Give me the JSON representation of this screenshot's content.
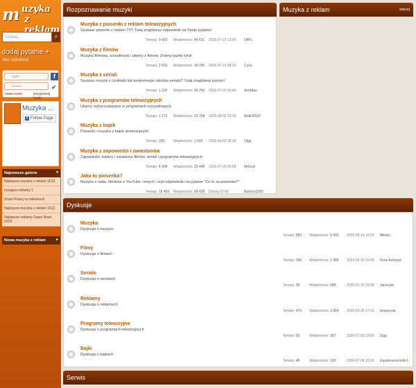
{
  "sidebar": {
    "logo_line1": "uzyka",
    "logo_line2": "z reklam",
    "logo_initial": "m",
    "search_placeholder": "Szukaj...",
    "ask_label": "dodaj pytanie +",
    "ask_sub": "bez rejestracji",
    "login_placeholder": "login",
    "password_placeholder": "••••••••",
    "new_account": "nowe konto",
    "forgot": "przypomnij hasło",
    "fb_title": "Muzyka ...",
    "fb_follow": "Follow Page",
    "latest_head": "Najnowsze galerie",
    "latest_links": [
      "Najlepsza muzyka z reklam 2013",
      "Irytujące reklamy 1",
      "Znani Polacy w reklamach",
      "Najlepsza muzyka z reklam 2012",
      "Najlepsze reklamy Super Bowl 2019"
    ],
    "new_music_head": "Nowa muzyka z reklam"
  },
  "recognition": {
    "title": "Rozpoznawanie muzyki",
    "rows": [
      {
        "title": "Muzyka z piosenki z reklam telewizyjnych",
        "desc": "Szukasz piosenki z reklam TV? Tutaj znajdziesz odpowiedź na Twoje pytanie!",
        "topics": "9 420",
        "posts": "44 611",
        "date": "2026-07-21 13:05",
        "user": "OliPL"
      },
      {
        "title": "Muzyka z filmów",
        "desc": "Muzyka filmowa, soundtracki i utwory z filmów. Znamy każdy tytuł!",
        "topics": "2 503",
        "posts": "18 295",
        "date": "2026-07-21 08:20",
        "user": "Cyna"
      },
      {
        "title": "Muzyka z seriali",
        "desc": "Szukasz muzyki z czołówki lub konkretnego odcinka serialu? Tutaj znajdziesz pomoc!",
        "topics": "1 232",
        "posts": "56 250",
        "date": "2026-07-20 00:40",
        "user": "AnnMaa"
      },
      {
        "title": "Muzyka z programów telewizyjnych",
        "desc": "Utwory wykorzystywane w programach rozrywkowych",
        "topics": "1 172",
        "posts": "23 758",
        "date": "2026-08-02 22:29",
        "user": "Malk25537"
      },
      {
        "title": "Muzyka z bajek",
        "desc": "Piosenki i muzyka z bajek animowanych",
        "topics": "330",
        "posts": "1 566",
        "date": "2026-04-02 09:39",
        "user": "Olga"
      },
      {
        "title": "Muzyka z zapowiedzi i zwiastunów",
        "desc": "Zapowiedzi, trailery i zwiastuny filmów, seriali i programów telewizyjnych",
        "topics": "4 099",
        "posts": "25 448",
        "date": "2026-07-20 02:58",
        "user": "MrKruk"
      },
      {
        "title": "Jaka to piosenka?",
        "desc": "Muzyka z radia, filmików z YouTube i innych, czyli odpowiedzi na pytanie \"Co to za piosenka?\"",
        "topics": "18 469",
        "posts": "68 609",
        "date": "Dzisiaj 03:09",
        "user": "Bartosz1992"
      }
    ]
  },
  "ads_panel": {
    "title": "Muzyka z reklam",
    "more": "więcej"
  },
  "discussions": {
    "title": "Dyskusje",
    "rows": [
      {
        "title": "Muzyka",
        "desc": "Dyskusja o muzyce",
        "topics": "850",
        "posts": "5 403",
        "date": "2026-05-14 12:53",
        "user": "Mimen"
      },
      {
        "title": "Filmy",
        "desc": "Dyskusja o filmach",
        "topics": "390",
        "posts": "1 368",
        "date": "2024-03-16 23:09",
        "user": "Fiora Ackroyd"
      },
      {
        "title": "Seriale",
        "desc": "Dyskusja o serialach",
        "topics": "90",
        "posts": "588",
        "date": "2025-01-16 20:08",
        "user": "Jareczka"
      },
      {
        "title": "Reklamy",
        "desc": "Dyskusja o reklamach",
        "topics": "470",
        "posts": "3 964",
        "date": "2026-03-20 17:13",
        "user": "bowarysia"
      },
      {
        "title": "Programy telewizyjne",
        "desc": "Dyskusja o programach telewizyjnych",
        "topics": "55",
        "posts": "187",
        "date": "2026-07-02 23:09",
        "user": "Zigg"
      },
      {
        "title": "Bajki",
        "desc": "Dyskusja o bajkach",
        "topics": "48",
        "posts": "195",
        "date": "2026-07-06 10:20",
        "user": "itsjustmemichelle1"
      }
    ]
  },
  "service": {
    "title": "Serwis"
  },
  "labels": {
    "topics": "Tematy:",
    "posts": "Wiadomości:"
  }
}
